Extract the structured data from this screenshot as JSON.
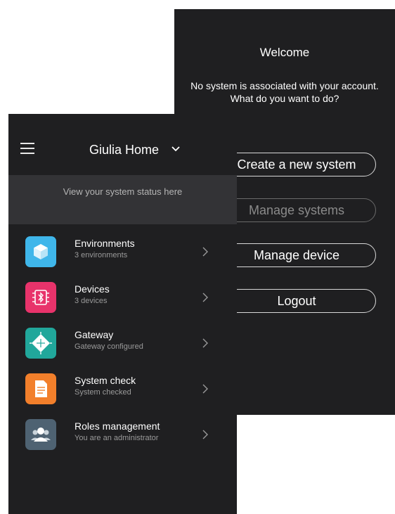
{
  "welcome": {
    "title": "Welcome",
    "message_line1": "No system is associated with your account.",
    "message_line2": "What do you want to do?",
    "buttons": [
      {
        "label": "Create a new system"
      },
      {
        "label": "Manage systems",
        "disabled": true
      },
      {
        "label": "Manage device"
      },
      {
        "label": "Logout"
      }
    ]
  },
  "home": {
    "title": "Giulia Home",
    "menu_icon": "hamburger-icon",
    "dropdown_icon": "chevron-down-icon",
    "status_banner": "View your system status here",
    "items": [
      {
        "title": "Environments",
        "subtitle": "3 environments",
        "icon": "cube-icon",
        "icon_color": "#3fb6ea"
      },
      {
        "title": "Devices",
        "subtitle": "3 devices",
        "icon": "bluetooth-chip-icon",
        "icon_color": "#e8336b"
      },
      {
        "title": "Gateway",
        "subtitle": "Gateway configured",
        "icon": "gateway-chip-icon",
        "icon_color": "#21a79b"
      },
      {
        "title": "System check",
        "subtitle": "System checked",
        "icon": "document-check-icon",
        "icon_color": "#f27f2b"
      },
      {
        "title": "Roles management",
        "subtitle": "You are an administrator",
        "icon": "users-icon",
        "icon_color": "#4e6272"
      }
    ]
  },
  "colors": {
    "background": "#1f1f21",
    "banner": "#333336"
  }
}
